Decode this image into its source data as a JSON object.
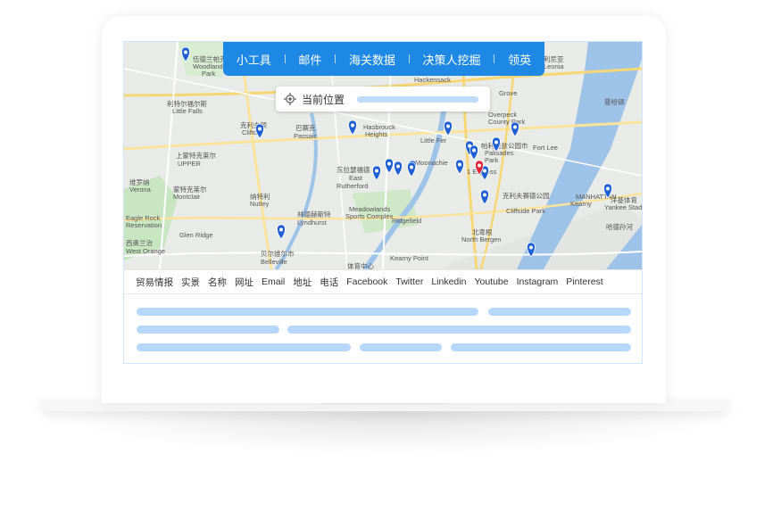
{
  "nav": {
    "items": [
      "小工具",
      "邮件",
      "海关数据",
      "决策人挖掘",
      "领英"
    ],
    "bg_color": "#1e88e5"
  },
  "location": {
    "label": "当前位置",
    "icon": "crosshair-icon"
  },
  "columns": [
    "贸易情报",
    "实景",
    "名称",
    "网址",
    "Email",
    "地址",
    "电话",
    "Facebook",
    "Twitter",
    "Linkedin",
    "Youtube",
    "Instagram",
    "Pinterest"
  ],
  "map": {
    "labels": [
      "伍德兰帕克",
      "Woodland",
      "Park",
      "利特尔福尔斯",
      "Little Falls",
      "小瀑布",
      "Little",
      "克利夫顿",
      "Clifton",
      "巴赛克",
      "Passaic",
      "上蒙特克莱尔",
      "UPPER",
      "MONTCLAIR",
      "维罗纳",
      "Verona",
      "蒙特克莱尔",
      "Montclair",
      "纳特利",
      "Nutley",
      "Eagle Rock",
      "Reservation",
      "Glen Ridge",
      "西奥兰治",
      "West Orange",
      "贝尔维尔市",
      "Belleville",
      "Hasbrouck",
      "Heights",
      "Hackensack",
      "Little Fer",
      "东拉瑟福德",
      "East",
      "Rutherford",
      "Moonachie",
      "林德赫斯特",
      "Lyndhurst",
      "Meadowlands",
      "Sports Complex",
      "北卑根",
      "North Bergen",
      "克利夫赛德公园",
      "Cliffside Park",
      "帕利塞兹公园市",
      "Palisades",
      "Park",
      "Fort Lee",
      "Overpeck",
      "County Park",
      "利尼亚",
      "Leonia",
      "洋基体育",
      "Yankee Stadium",
      "哈德孙河",
      "HARLEM",
      "曼哈顿",
      "MANHATTAN",
      "Kearny",
      "Kearny Point",
      "Bernard W De",
      "体育中心",
      "Ridgefield",
      "1 Express",
      "Grove",
      "Cedar Grove"
    ],
    "pins": {
      "blue_count": 21,
      "red_count": 1
    }
  },
  "rows": {
    "count": 3
  }
}
